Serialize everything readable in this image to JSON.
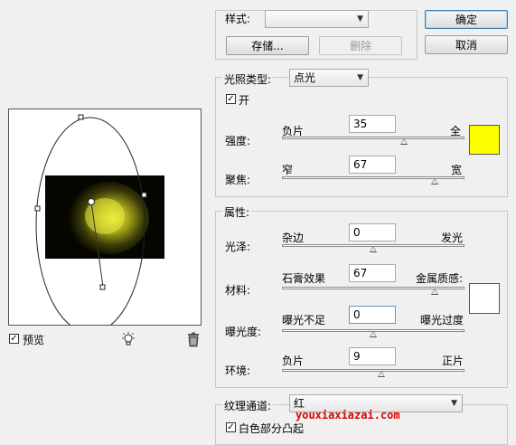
{
  "buttons": {
    "ok": "确定",
    "cancel": "取消",
    "save": "存储...",
    "delete": "删除"
  },
  "style": {
    "label": "样式:",
    "value": ""
  },
  "light": {
    "type_label": "光照类型:",
    "type_value": "点光",
    "on_label": "开",
    "on_checked": true,
    "intensity": {
      "label": "强度:",
      "min_label": "负片",
      "max_label": "全",
      "value": "35",
      "fraction": 0.67
    },
    "focus": {
      "label": "聚焦:",
      "min_label": "窄",
      "max_label": "宽",
      "value": "67",
      "fraction": 0.835
    },
    "color": "#ffff00"
  },
  "properties": {
    "title": "属性:",
    "gloss": {
      "label": "光泽:",
      "min_label": "杂边",
      "max_label": "发光",
      "value": "0",
      "fraction": 0.5
    },
    "material": {
      "label": "材料:",
      "min_label": "石膏效果",
      "max_label": "金属质感:",
      "value": "67",
      "fraction": 0.835
    },
    "exposure": {
      "label": "曝光度:",
      "min_label": "曝光不足",
      "max_label": "曝光过度",
      "value": "0",
      "fraction": 0.5
    },
    "ambience": {
      "label": "环境:",
      "min_label": "负片",
      "max_label": "正片",
      "value": "9",
      "fraction": 0.545
    },
    "color": "#ffffff"
  },
  "texture": {
    "channel_label": "纹理通道:",
    "channel_value": "红",
    "white_high_label": "白色部分凸起",
    "white_high_checked": true
  },
  "preview": {
    "label": "预览",
    "checked": true
  },
  "icons": {
    "light": "light-bulb-icon",
    "trash": "trash-icon"
  },
  "watermark": "youxiaxiazai.com"
}
